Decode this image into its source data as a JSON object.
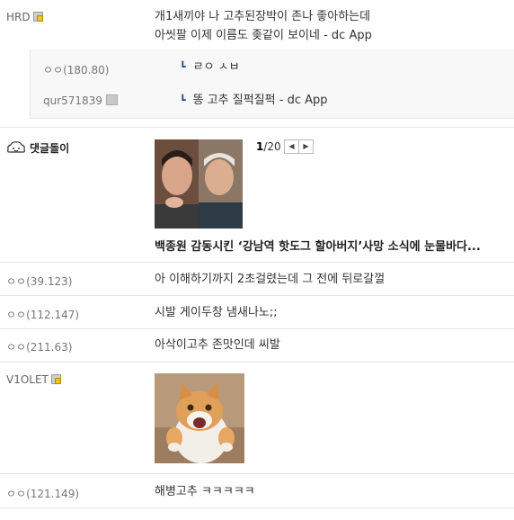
{
  "comments": [
    {
      "nick": "HRD",
      "lines": [
        "개1새끼야 나 고추된장박이 존나 좋아하는데",
        "아씻팔 이제 이름도 좆같이 보이네 - dc App"
      ]
    },
    {
      "nick": "ㅇㅇ",
      "ip": "(180.80)",
      "text": "ㄹㅇ ㅅㅂ"
    },
    {
      "nick": "qur571839",
      "text": "똥 고추 질퍽질퍽 - dc App"
    },
    {
      "nick": "댓글돌이",
      "pager": {
        "current": "1",
        "total": "/20"
      },
      "title": "백종원 감동시킨 ‘강남역 핫도그 할아버지’사망 소식에 눈물바다..."
    },
    {
      "nick": "ㅇㅇ",
      "ip": "(39.123)",
      "text": "아 이해하기까지 2초걸렸는데 그 전에 뒤로갈껄"
    },
    {
      "nick": "ㅇㅇ",
      "ip": "(112.147)",
      "text": "시발 게이두창 냄새나노;;"
    },
    {
      "nick": "ㅇㅇ",
      "ip": "(211.63)",
      "text": "아삭이고추 존맛인데 씨발"
    },
    {
      "nick": "V1OLET"
    },
    {
      "nick": "ㅇㅇ",
      "ip": "(121.149)",
      "text": "해병고추 ㅋㅋㅋㅋㅋ"
    }
  ],
  "colors": {
    "reply_arrow": "#1e3c8c",
    "badge_yellow": "#f1c21b",
    "divider": "#e6e6e6"
  },
  "icons": [
    "lock-badge-icon",
    "gray-badge-icon",
    "bot-face-icon",
    "reply-arrow-icon",
    "prev-page-icon",
    "next-page-icon"
  ]
}
